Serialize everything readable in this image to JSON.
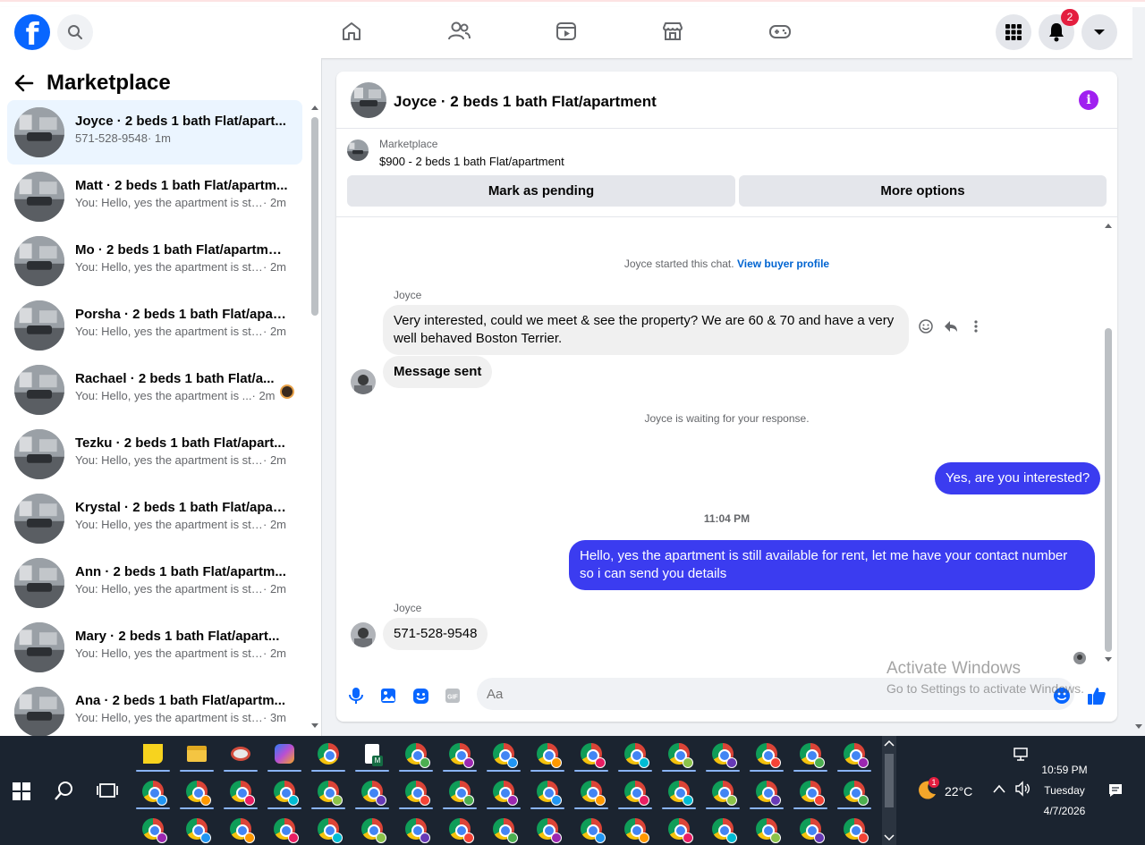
{
  "header": {
    "logo": "f",
    "notifications_count": "2"
  },
  "sidebar": {
    "title": "Marketplace",
    "conversations": [
      {
        "title": "Joyce · 2 beds 1 bath Flat/apart...",
        "message": "571-528-9548",
        "time": " · 1m",
        "active": true
      },
      {
        "title": "Matt · 2 beds 1 bath Flat/apartm...",
        "message": "You: Hello, yes the apartment is stil...",
        "time": " · 2m"
      },
      {
        "title": "Mo · 2 beds 1 bath Flat/apartment",
        "message": "You: Hello, yes the apartment is stil...",
        "time": " · 2m"
      },
      {
        "title": "Porsha · 2 beds 1 bath Flat/apart...",
        "message": "You: Hello, yes the apartment is stil...",
        "time": " · 2m"
      },
      {
        "title": "Rachael · 2 beds 1 bath Flat/a...",
        "message": "You: Hello, yes the apartment is ...",
        "time": " · 2m"
      },
      {
        "title": "Tezku · 2 beds 1 bath Flat/apart...",
        "message": "You: Hello, yes the apartment is stil...",
        "time": " · 2m"
      },
      {
        "title": "Krystal · 2 beds 1 bath Flat/apart...",
        "message": "You: Hello, yes the apartment is stil...",
        "time": " · 2m"
      },
      {
        "title": "Ann · 2 beds 1 bath Flat/apartm...",
        "message": "You: Hello, yes the apartment is stil...",
        "time": " · 2m"
      },
      {
        "title": "Mary · 2 beds 1 bath Flat/apart...",
        "message": "You: Hello, yes the apartment is stil...",
        "time": " · 2m"
      },
      {
        "title": "Ana · 2 beds 1 bath Flat/apartm...",
        "message": "You: Hello, yes the apartment is stil...",
        "time": " · 3m"
      }
    ]
  },
  "chat": {
    "title": "Joyce · 2 beds 1 bath Flat/apartment",
    "listing_source": "Marketplace",
    "listing_title": "$900 - 2 beds 1 bath Flat/apartment",
    "mark_pending_label": "Mark as pending",
    "more_options_label": "More options",
    "started_text": "Joyce started this chat.",
    "buyer_profile_link": "View buyer profile",
    "sender_1": "Joyce",
    "msg_1": "Very interested, could we meet & see the property? We are 60 & 70 and have a very well behaved Boston Terrier.",
    "msg_2": "Message sent",
    "waiting_text": "Joyce is waiting for your response.",
    "msg_3": "Yes, are you interested?",
    "timestamp": "11:04 PM",
    "msg_4": "Hello, yes the apartment is still available for rent, let me have your contact number so i can send you details",
    "sender_2": "Joyce",
    "msg_5": "571-528-9548",
    "composer_placeholder": "Aa"
  },
  "watermark": {
    "line1": "Activate Windows",
    "line2": "Go to Settings to activate Windows."
  },
  "taskbar": {
    "temperature": "22°C",
    "weather_badge": "1",
    "time": "10:59 PM",
    "day": "Tuesday",
    "date": "4/7/2026"
  },
  "colors": {
    "brand": "#0866ff",
    "outgoing_bubble": "#3b3cf0",
    "active_row": "#ebf5ff",
    "info_icon": "#a020f0",
    "notification_badge": "#e41e3f"
  }
}
